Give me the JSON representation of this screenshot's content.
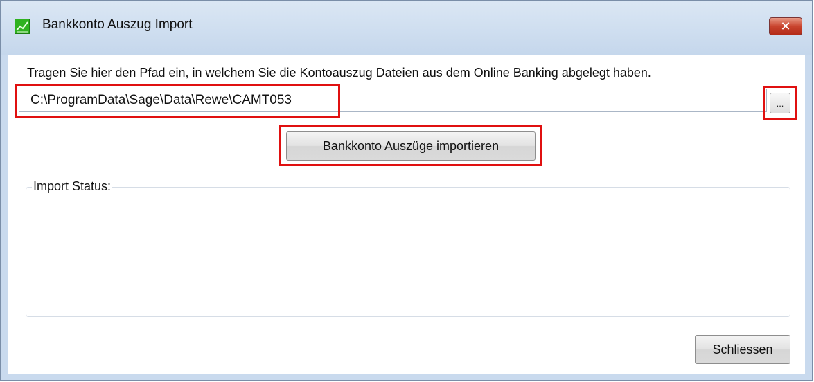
{
  "window": {
    "title": "Bankkonto Auszug Import",
    "close_glyph": "✕",
    "icon": "chart-app-icon"
  },
  "main": {
    "instruction": "Tragen Sie hier den Pfad ein, in welchem Sie die Kontoauszug Dateien aus dem Online Banking abgelegt haben.",
    "path_value": "C:\\ProgramData\\Sage\\Data\\Rewe\\CAMT053",
    "browse_label": "...",
    "import_button_label": "Bankkonto Auszüge importieren",
    "status_group_label": "Import Status:",
    "status_text": "",
    "close_button_label": "Schliessen"
  },
  "colors": {
    "highlight": "#e01010",
    "window_frame": "#c9daee",
    "close_button": "#c9442e"
  }
}
